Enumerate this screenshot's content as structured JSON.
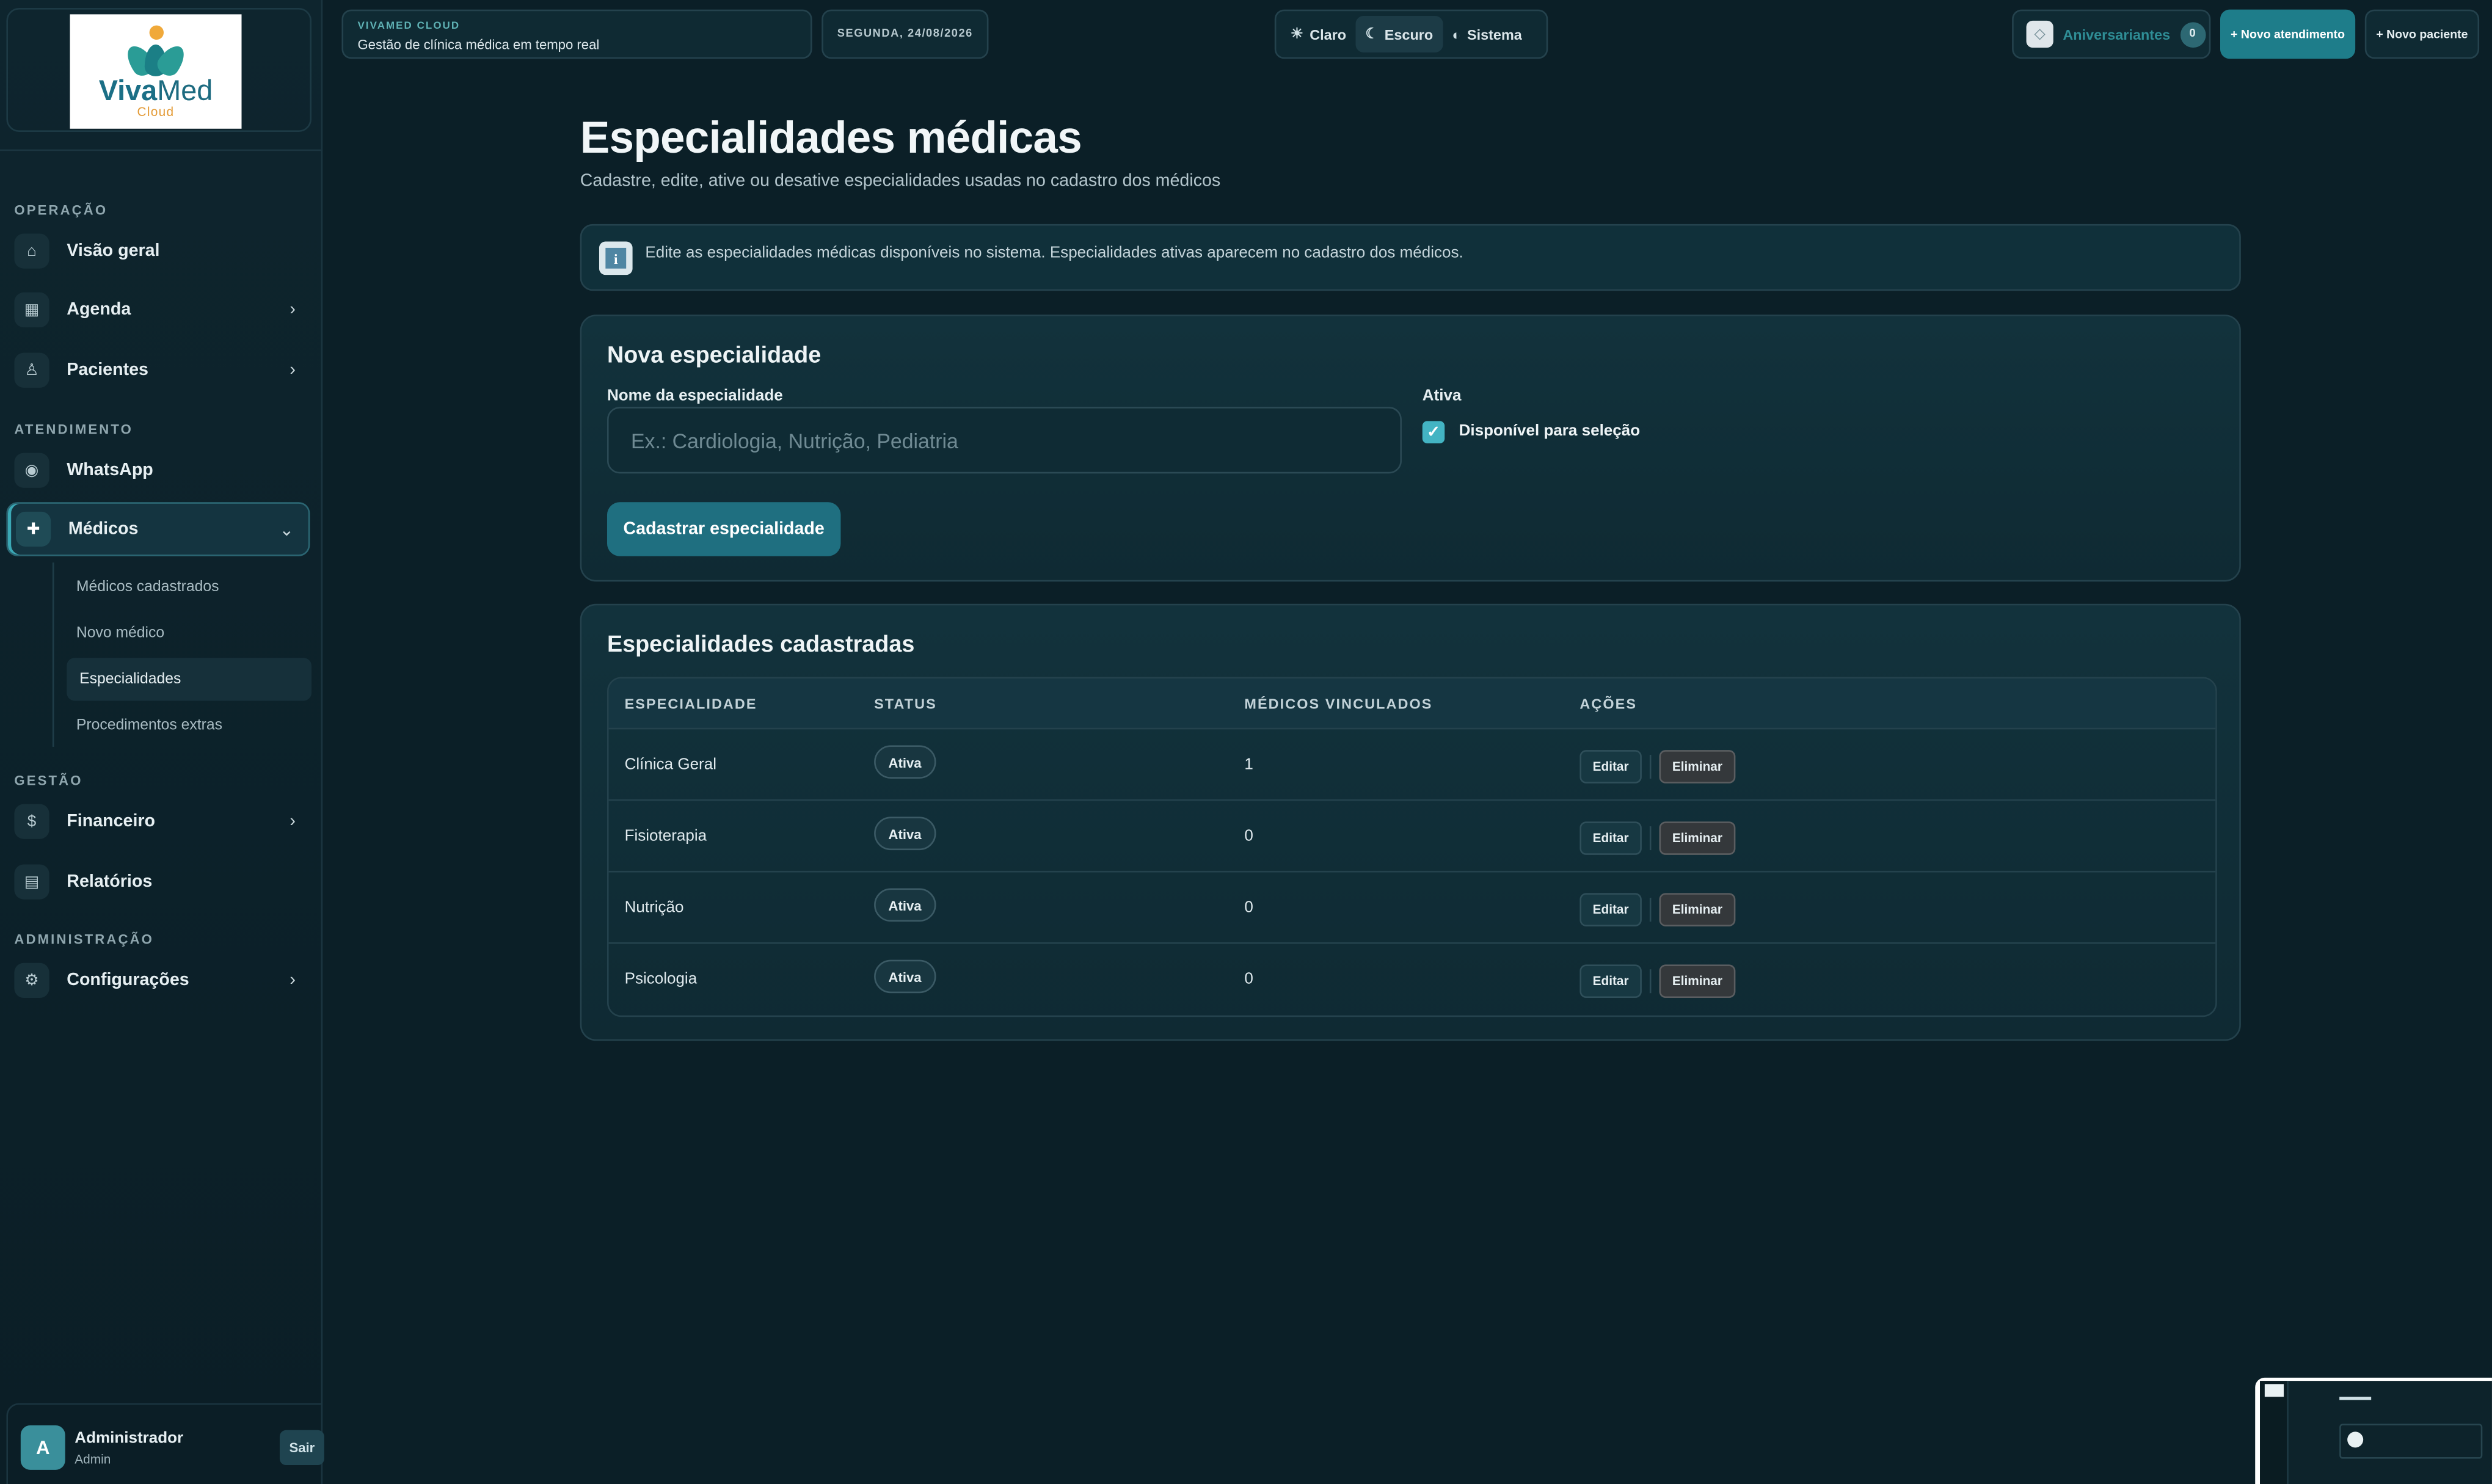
{
  "brand": {
    "logo_word_bold": "Viva",
    "logo_word": "Med",
    "logo_sub": "Cloud",
    "eyebrow": "VIVAMED CLOUD",
    "subtitle": "Gestão de clínica médica em tempo real"
  },
  "header": {
    "date": "SEGUNDA, 24/08/2026",
    "themes": [
      {
        "label": "Claro",
        "icon": "sun-icon",
        "glyph": "☀"
      },
      {
        "label": "Escuro",
        "icon": "moon-icon",
        "glyph": "☾"
      },
      {
        "label": "Sistema",
        "icon": "half-circle-icon",
        "glyph": "◐"
      }
    ],
    "active_theme": "Escuro",
    "birthdays_label": "Aniversariantes",
    "birthdays_count": "0",
    "new_appointment": "+ Novo atendimento",
    "new_patient": "+ Novo paciente"
  },
  "sidebar": {
    "sections": {
      "operacao": "OPERAÇÃO",
      "atendimento": "ATENDIMENTO",
      "gestao": "GESTÃO",
      "administracao": "ADMINISTRAÇÃO"
    },
    "items": {
      "visao_geral": "Visão geral",
      "agenda": "Agenda",
      "pacientes": "Pacientes",
      "whatsapp": "WhatsApp",
      "medicos": "Médicos",
      "financeiro": "Financeiro",
      "relatorios": "Relatórios",
      "configuracoes": "Configurações"
    },
    "medicos_sub": {
      "cadastrados": "Médicos cadastrados",
      "novo": "Novo médico",
      "especialidades": "Especialidades",
      "procedimentos": "Procedimentos extras"
    },
    "user": {
      "initial": "A",
      "name": "Administrador",
      "role": "Admin",
      "logout": "Sair"
    }
  },
  "page": {
    "title": "Especialidades médicas",
    "subtitle": "Cadastre, edite, ative ou desative especialidades usadas no cadastro dos médicos",
    "info": "Edite as especialidades médicas disponíveis no sistema. Especialidades ativas aparecem no cadastro dos médicos."
  },
  "form": {
    "title": "Nova especialidade",
    "name_label": "Nome da especialidade",
    "name_placeholder": "Ex.: Cardiologia, Nutrição, Pediatria",
    "name_value": "",
    "active_label": "Ativa",
    "active_checkbox_label": "Disponível para seleção",
    "active_checked": true,
    "submit": "Cadastrar especialidade"
  },
  "table": {
    "title": "Especialidades cadastradas",
    "columns": [
      "ESPECIALIDADE",
      "STATUS",
      "MÉDICOS VINCULADOS",
      "AÇÕES"
    ],
    "edit_label": "Editar",
    "delete_label": "Eliminar",
    "rows": [
      {
        "name": "Clínica Geral",
        "status": "Ativa",
        "doctors": "1"
      },
      {
        "name": "Fisioterapia",
        "status": "Ativa",
        "doctors": "0"
      },
      {
        "name": "Nutrição",
        "status": "Ativa",
        "doctors": "0"
      },
      {
        "name": "Psicologia",
        "status": "Ativa",
        "doctors": "0"
      }
    ]
  },
  "colors": {
    "accent": "#1e7d8a",
    "background": "#0b1f27",
    "checkbox": "#43b4c3"
  }
}
